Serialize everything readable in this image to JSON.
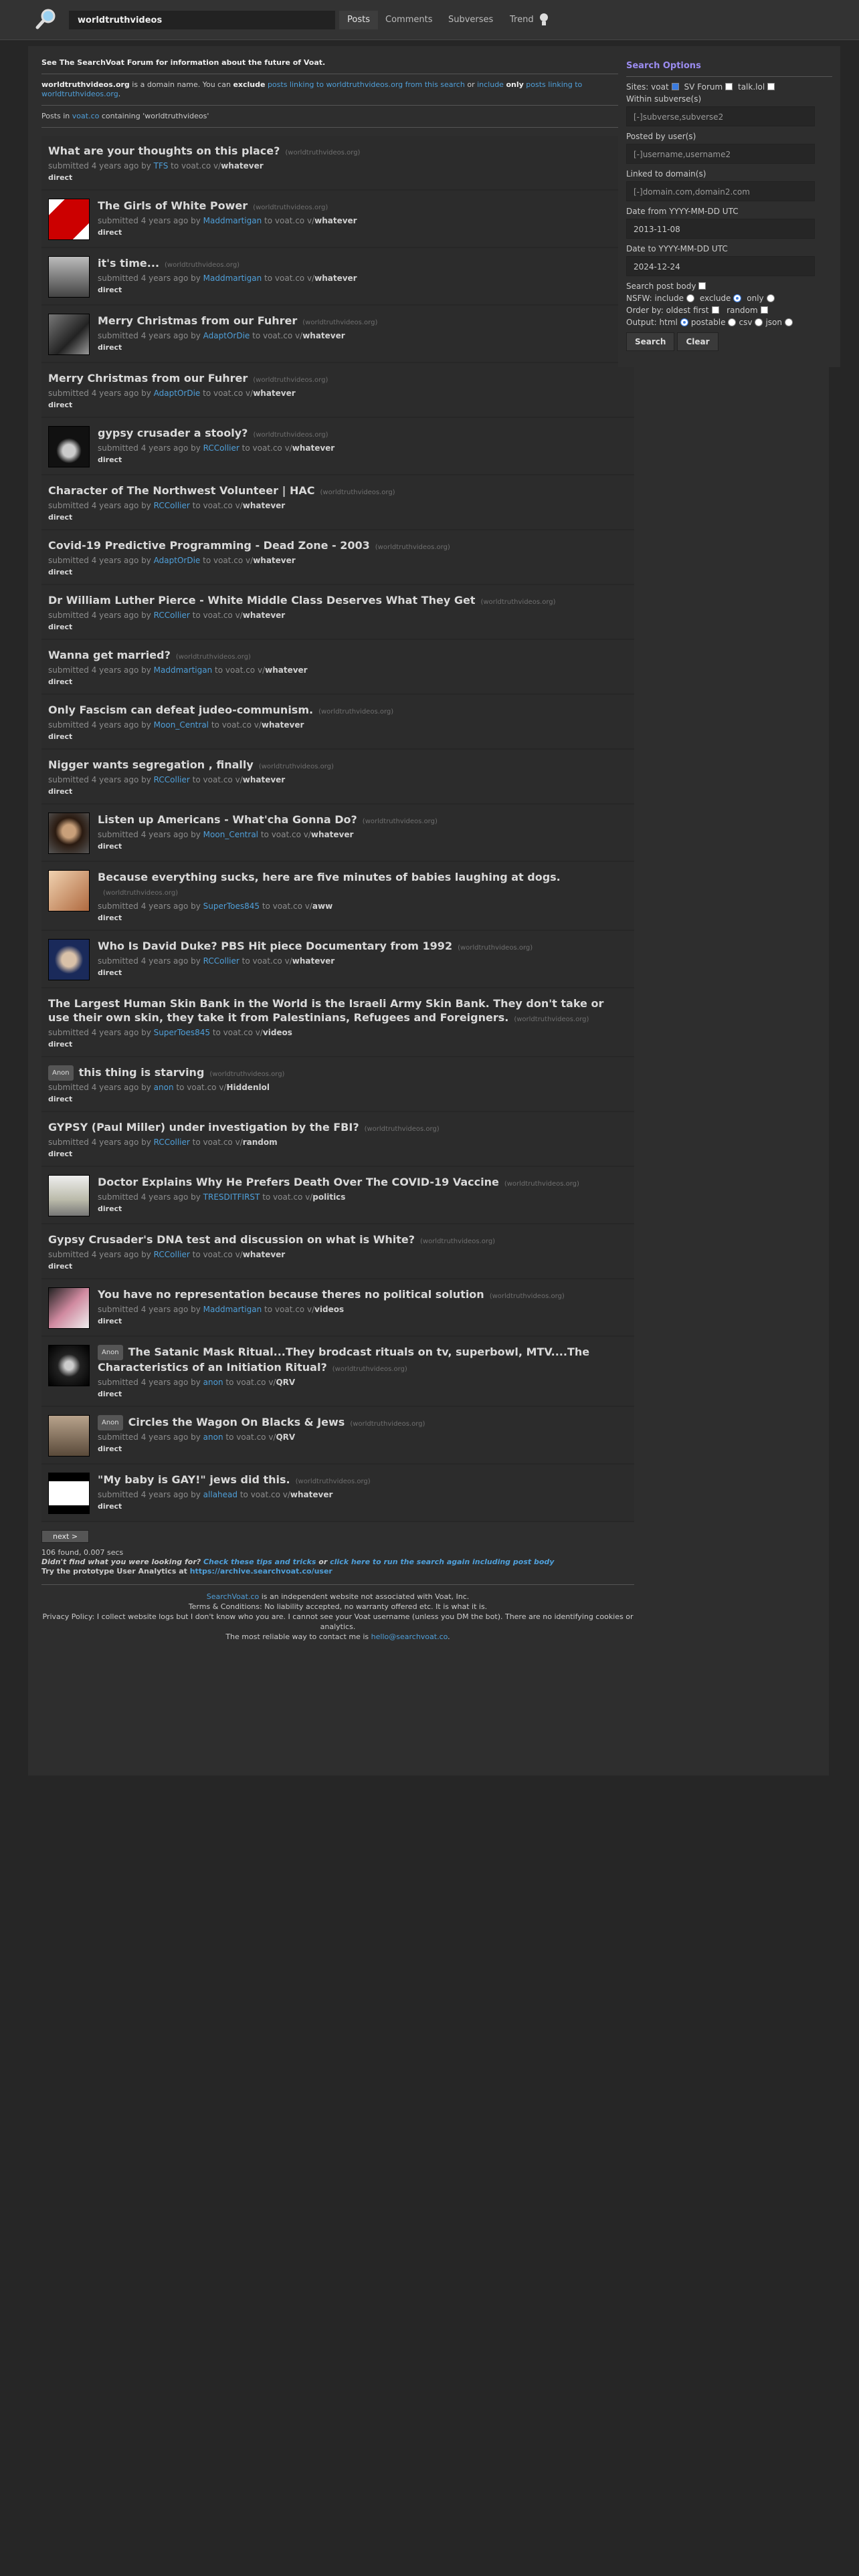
{
  "header": {
    "search_value": "worldtruthvideos",
    "tabs": [
      "Posts",
      "Comments",
      "Subverses",
      "Trend"
    ]
  },
  "notice": {
    "see": "See ",
    "forum": "The SearchVoat Forum",
    "forum_tail": " for information about the future of Voat.",
    "dom1": "worldtruthvideos.org",
    "dom_mid": " is a domain name. You can ",
    "exclude": "exclude",
    "link1": "posts linking to worldtruthvideos.org from this search",
    "or": " or ",
    "include": "include",
    "only": "only",
    "link2": "posts linking to worldtruthvideos.org",
    "dot": ".",
    "posts_in": "Posts in ",
    "voat": "voat.co",
    "containing": " containing 'worldtruthvideos'"
  },
  "submitted_pre": "submitted 4 years ago by ",
  "to_voat": " to voat.co v/",
  "direct": "direct",
  "anon_badge": "Anon",
  "posts": [
    {
      "title": "What are your thoughts on this place?",
      "domain": "(worldtruthvideos.org)",
      "user": "TFS",
      "sub": "whatever",
      "thumb": null
    },
    {
      "title": "The Girls of White Power",
      "domain": "(worldtruthvideos.org)",
      "user": "Maddmartigan",
      "sub": "whatever",
      "thumb": "red"
    },
    {
      "title": "it's time...",
      "domain": "(worldtruthvideos.org)",
      "user": "Maddmartigan",
      "sub": "whatever",
      "thumb": "grey"
    },
    {
      "title": "Merry Christmas from our Fuhrer",
      "domain": "(worldtruthvideos.org)",
      "user": "AdaptOrDie",
      "sub": "whatever",
      "thumb": "mono"
    },
    {
      "title": "Merry Christmas from our Fuhrer",
      "domain": "(worldtruthvideos.org)",
      "user": "AdaptOrDie",
      "sub": "whatever",
      "thumb": null
    },
    {
      "title": "gypsy crusader a stooly?",
      "domain": "(worldtruthvideos.org)",
      "user": "RCCollier",
      "sub": "whatever",
      "thumb": "dark"
    },
    {
      "title": "Character of The Northwest Volunteer | HAC",
      "domain": "(worldtruthvideos.org)",
      "user": "RCCollier",
      "sub": "whatever",
      "thumb": null
    },
    {
      "title": "Covid-19 Predictive Programming - Dead Zone - 2003",
      "domain": "(worldtruthvideos.org)",
      "user": "AdaptOrDie",
      "sub": "whatever",
      "thumb": null
    },
    {
      "title": "Dr William Luther Pierce - White Middle Class Deserves What They Get",
      "domain": "(worldtruthvideos.org)",
      "user": "RCCollier",
      "sub": "whatever",
      "thumb": null
    },
    {
      "title": "Wanna get married?",
      "domain": "(worldtruthvideos.org)",
      "user": "Maddmartigan",
      "sub": "whatever",
      "thumb": null
    },
    {
      "title": "Only Fascism can defeat judeo-communism.",
      "domain": "(worldtruthvideos.org)",
      "user": "Moon_Central",
      "sub": "whatever",
      "thumb": null
    },
    {
      "title": "Nigger wants segregation , finally",
      "domain": "(worldtruthvideos.org)",
      "user": "RCCollier",
      "sub": "whatever",
      "thumb": null
    },
    {
      "title": "Listen up Americans - What'cha Gonna Do?",
      "domain": "(worldtruthvideos.org)",
      "user": "Moon_Central",
      "sub": "whatever",
      "thumb": "face"
    },
    {
      "title": "Because everything sucks, here are five minutes of babies laughing at dogs.",
      "domain": "(worldtruthvideos.org)",
      "user": "SuperToes845",
      "sub": "aww",
      "thumb": "warm"
    },
    {
      "title": "Who Is David Duke? PBS Hit piece Documentary from 1992",
      "domain": "(worldtruthvideos.org)",
      "user": "RCCollier",
      "sub": "whatever",
      "thumb": "blue"
    },
    {
      "title": "The Largest Human Skin Bank in the World is the Israeli Army Skin Bank. They don't take or use their own skin, they take it from Palestinians, Refugees and Foreigners.",
      "domain": "(worldtruthvideos.org)",
      "user": "SuperToes845",
      "sub": "videos",
      "thumb": null
    },
    {
      "title": "this thing is starving",
      "domain": "(worldtruthvideos.org)",
      "user": "anon",
      "sub": "Hiddenlol",
      "thumb": null,
      "anon": true
    },
    {
      "title": "GYPSY (Paul Miller) under investigation by the FBI?",
      "domain": "(worldtruthvideos.org)",
      "user": "RCCollier",
      "sub": "random",
      "thumb": null
    },
    {
      "title": "Doctor Explains Why He Prefers Death Over The COVID-19 Vaccine",
      "domain": "(worldtruthvideos.org)",
      "user": "TRESDITFIRST",
      "sub": "politics",
      "thumb": "light"
    },
    {
      "title": "Gypsy Crusader's DNA test and discussion on what is White?",
      "domain": "(worldtruthvideos.org)",
      "user": "RCCollier",
      "sub": "whatever",
      "thumb": null
    },
    {
      "title": "You have no representation because theres no political solution",
      "domain": "(worldtruthvideos.org)",
      "user": "Maddmartigan",
      "sub": "videos",
      "thumb": "pink"
    },
    {
      "title": "The Satanic Mask Ritual...They brodcast rituals on tv, superbowl, MTV....The Characteristics of an Initiation Ritual?",
      "domain": "(worldtruthvideos.org)",
      "user": "anon",
      "sub": "QRV",
      "thumb": "dark2",
      "anon": true
    },
    {
      "title": "Circles the Wagon On Blacks & Jews",
      "domain": "(worldtruthvideos.org)",
      "user": "anon",
      "sub": "QRV",
      "thumb": "street",
      "anon": true
    },
    {
      "title": "\"My baby is GAY!\" jews did this.",
      "domain": "(worldtruthvideos.org)",
      "user": "allahead",
      "sub": "whatever",
      "thumb": "card"
    }
  ],
  "pager": {
    "next": "next >",
    "found": "106 found, 0.007 secs",
    "didnt": "Didn't find what you were looking for? ",
    "tips": "Check these tips and tricks",
    "or": " or ",
    "again": "click here to run the search again including post body",
    "try": "Try the prototype User Analytics at ",
    "archive": "https://archive.searchvoat.co/user"
  },
  "footer": {
    "sv": "SearchVoat.co",
    "l1": " is an independent website not associated with Voat, Inc.",
    "l2": "Terms & Conditions: No liability accepted, no warranty offered etc. It is what it is.",
    "l3": "Privacy Policy: I collect website logs but I don't know who you are. I cannot see your Voat username (unless you DM the bot). There are no identifying cookies or analytics.",
    "l4": "The most reliable way to contact me is ",
    "email": "hello@searchvoat.co",
    "dot": "."
  },
  "options": {
    "heading": "Search Options",
    "sites": "Sites: voat",
    "sv_forum": "SV Forum",
    "talk": "talk.lol",
    "within": "Within subverse(s)",
    "within_ph": "[-]subverse,subverse2",
    "posted": "Posted by user(s)",
    "posted_ph": "[-]username,username2",
    "linked": "Linked to domain(s)",
    "linked_ph": "[-]domain.com,domain2.com",
    "from": "Date from YYYY-MM-DD UTC",
    "from_val": "2013-11-08",
    "to": "Date to YYYY-MM-DD UTC",
    "to_val": "2024-12-24",
    "body": "Search post body",
    "nsfw": "NSFW: include",
    "exclude": "exclude",
    "only": "only",
    "order": "Order by: oldest first",
    "random": "random",
    "output": "Output: html",
    "postable": "postable",
    "csv": "csv",
    "json": "json",
    "search": "Search",
    "clear": "Clear"
  },
  "colors": {
    "link": "#4f9fd9",
    "accent": "#9b8cf0"
  }
}
